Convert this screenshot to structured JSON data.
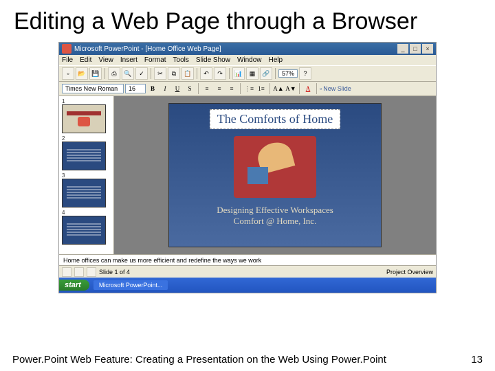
{
  "page": {
    "title": "Editing a Web Page through a Browser",
    "footer": "Power.Point Web Feature: Creating a Presentation on the Web Using Power.Point",
    "number": "13"
  },
  "titlebar": {
    "app": "Microsoft PowerPoint - [Home Office Web Page]"
  },
  "menu": {
    "file": "File",
    "edit": "Edit",
    "view": "View",
    "insert": "Insert",
    "format": "Format",
    "tools": "Tools",
    "slideshow": "Slide Show",
    "window": "Window",
    "help": "Help"
  },
  "toolbar": {
    "zoom": "57%",
    "font": "Times New Roman",
    "size": "16",
    "newslide": "New Slide"
  },
  "slide": {
    "title": "The Comforts of Home",
    "sub1": "Designing Effective Workspaces",
    "sub2": "Comfort @ Home, Inc."
  },
  "notes": {
    "text": "Home offices can make us more efficient and redefine the ways we work"
  },
  "bottombar": {
    "label1": "Slide 1 of 4",
    "label2": "Project Overview"
  },
  "taskbar": {
    "start": "start",
    "item1": "Microsoft PowerPoint..."
  },
  "thumbs": [
    "1",
    "2",
    "3",
    "4"
  ]
}
